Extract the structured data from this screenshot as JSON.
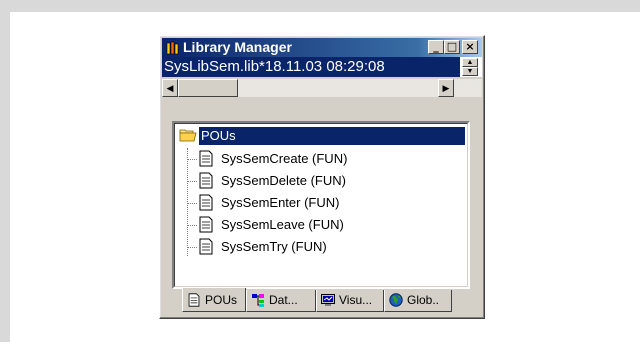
{
  "window": {
    "title": "Library Manager",
    "library_entry": "SysLibSem.lib*18.11.03 08:29:08",
    "controls": {
      "minimize": "_",
      "maximize": "□",
      "close": "×"
    }
  },
  "tree": {
    "root": {
      "label": "POUs",
      "icon": "folder-open-icon"
    },
    "items": [
      {
        "label": "SysSemCreate (FUN)",
        "icon": "document-icon"
      },
      {
        "label": "SysSemDelete (FUN)",
        "icon": "document-icon"
      },
      {
        "label": "SysSemEnter (FUN)",
        "icon": "document-icon"
      },
      {
        "label": "SysSemLeave (FUN)",
        "icon": "document-icon"
      },
      {
        "label": "SysSemTry (FUN)",
        "icon": "document-icon"
      }
    ]
  },
  "tabs": [
    {
      "label": "POUs",
      "icon": "document-icon",
      "active": true
    },
    {
      "label": "Dat...",
      "icon": "data-types-icon",
      "active": false
    },
    {
      "label": "Visu...",
      "icon": "visualization-icon",
      "active": false
    },
    {
      "label": "Glob..",
      "icon": "globe-icon",
      "active": false
    }
  ],
  "colors": {
    "titlebar": "#0a246a",
    "selection": "#0a246a",
    "face": "#d4d0c8"
  }
}
